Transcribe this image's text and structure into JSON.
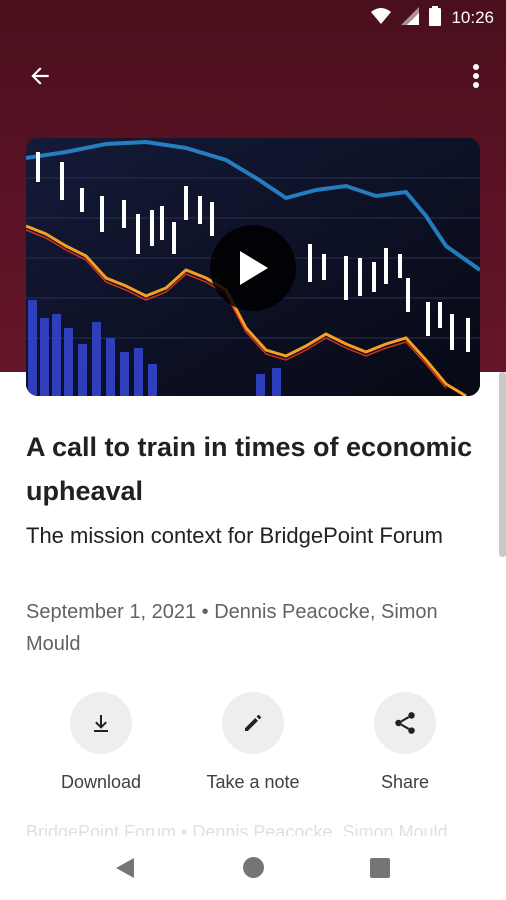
{
  "status_bar": {
    "time": "10:26"
  },
  "app_bar": {
    "back_icon": "arrow-back-icon",
    "more_icon": "more-vert-icon"
  },
  "video": {
    "play_icon": "play-icon"
  },
  "article": {
    "title": "A call to train in times of economic upheaval",
    "subtitle": "The mission context for BridgePoint Forum",
    "meta": "September 1, 2021 • Dennis Peacocke, Simon Mould"
  },
  "actions": [
    {
      "label": "Download",
      "icon": "download-icon"
    },
    {
      "label": "Take a note",
      "icon": "pencil-icon"
    },
    {
      "label": "Share",
      "icon": "share-icon"
    }
  ],
  "faded_text": "BridgePoint Forum • Dennis Peacocke, Simon Mould",
  "colors": {
    "hero": "#5c1325",
    "circle_bg": "#eeeeee",
    "text": "#202124",
    "muted": "#5f6368"
  }
}
